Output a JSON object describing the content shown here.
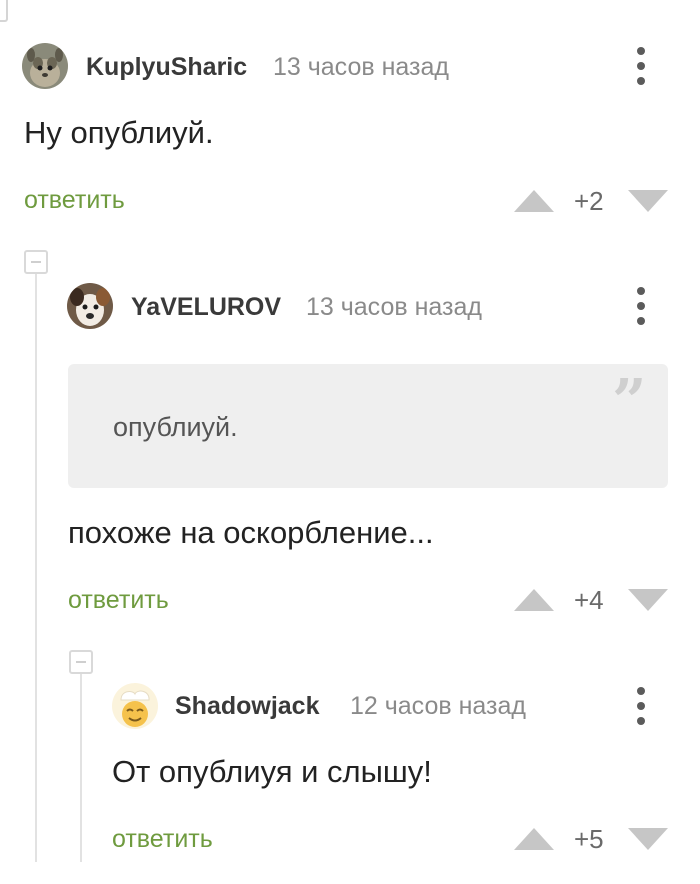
{
  "comments": [
    {
      "username": "KuplyuSharic",
      "timestamp": "13 часов назад",
      "text": "Ну опублиуй.",
      "reply_label": "ответить",
      "score": "+2",
      "avatar_icon": "squirrel-avatar"
    },
    {
      "username": "YaVELUROV",
      "timestamp": "13 часов назад",
      "quote": "опублиуй.",
      "text": "похоже на оскорбление...",
      "reply_label": "ответить",
      "score": "+4",
      "avatar_icon": "dog-avatar"
    },
    {
      "username": "Shadowjack",
      "timestamp": "12 часов назад",
      "text": "От опублиуя и слышу!",
      "reply_label": "ответить",
      "score": "+5",
      "avatar_icon": "chef-emoji-avatar"
    }
  ],
  "colors": {
    "reply_link": "#6f9b3f",
    "vote_arrow": "#c6c6c6",
    "quote_bg": "#efefef",
    "thread_line": "#e2e2e2"
  }
}
